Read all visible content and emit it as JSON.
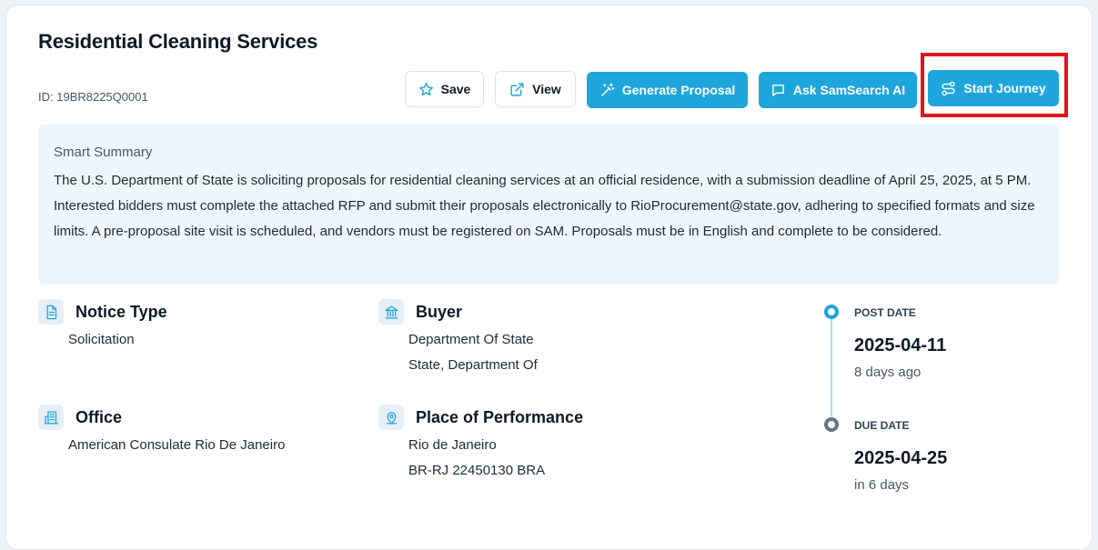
{
  "header": {
    "title": "Residential Cleaning Services",
    "notice_id": "ID: 19BR8225Q0001"
  },
  "actions": {
    "save": "Save",
    "view": "View",
    "generate_proposal": "Generate Proposal",
    "ask_ai": "Ask SamSearch AI",
    "start_journey": "Start Journey"
  },
  "summary": {
    "label": "Smart Summary",
    "text": "The U.S. Department of State is soliciting proposals for residential cleaning services at an official residence, with a submission deadline of April 25, 2025, at 5 PM. Interested bidders must complete the attached RFP and submit their proposals electronically to RioProcurement@state.gov, adhering to specified formats and size limits. A pre-proposal site visit is scheduled, and vendors must be registered on SAM. Proposals must be in English and complete to be considered."
  },
  "fields": {
    "notice_type": {
      "title": "Notice Type",
      "value": "Solicitation"
    },
    "buyer": {
      "title": "Buyer",
      "line1": "Department Of State",
      "line2": "State, Department Of"
    },
    "office": {
      "title": "Office",
      "value": "American Consulate Rio De Janeiro"
    },
    "place": {
      "title": "Place of Performance",
      "line1": "Rio de Janeiro",
      "line2": "BR-RJ 22450130 BRA"
    }
  },
  "timeline": {
    "post": {
      "label": "POST DATE",
      "date": "2025-04-11",
      "relative": "8 days ago"
    },
    "due": {
      "label": "DUE DATE",
      "date": "2025-04-25",
      "relative": "in 6 days"
    }
  },
  "colors": {
    "primary": "#1ea5dc",
    "highlight": "#e3141b"
  },
  "icons": {
    "save": "star-icon",
    "view": "external-link-icon",
    "generate": "magic-wand-icon",
    "ask": "chat-bubble-icon",
    "journey": "route-icon"
  }
}
